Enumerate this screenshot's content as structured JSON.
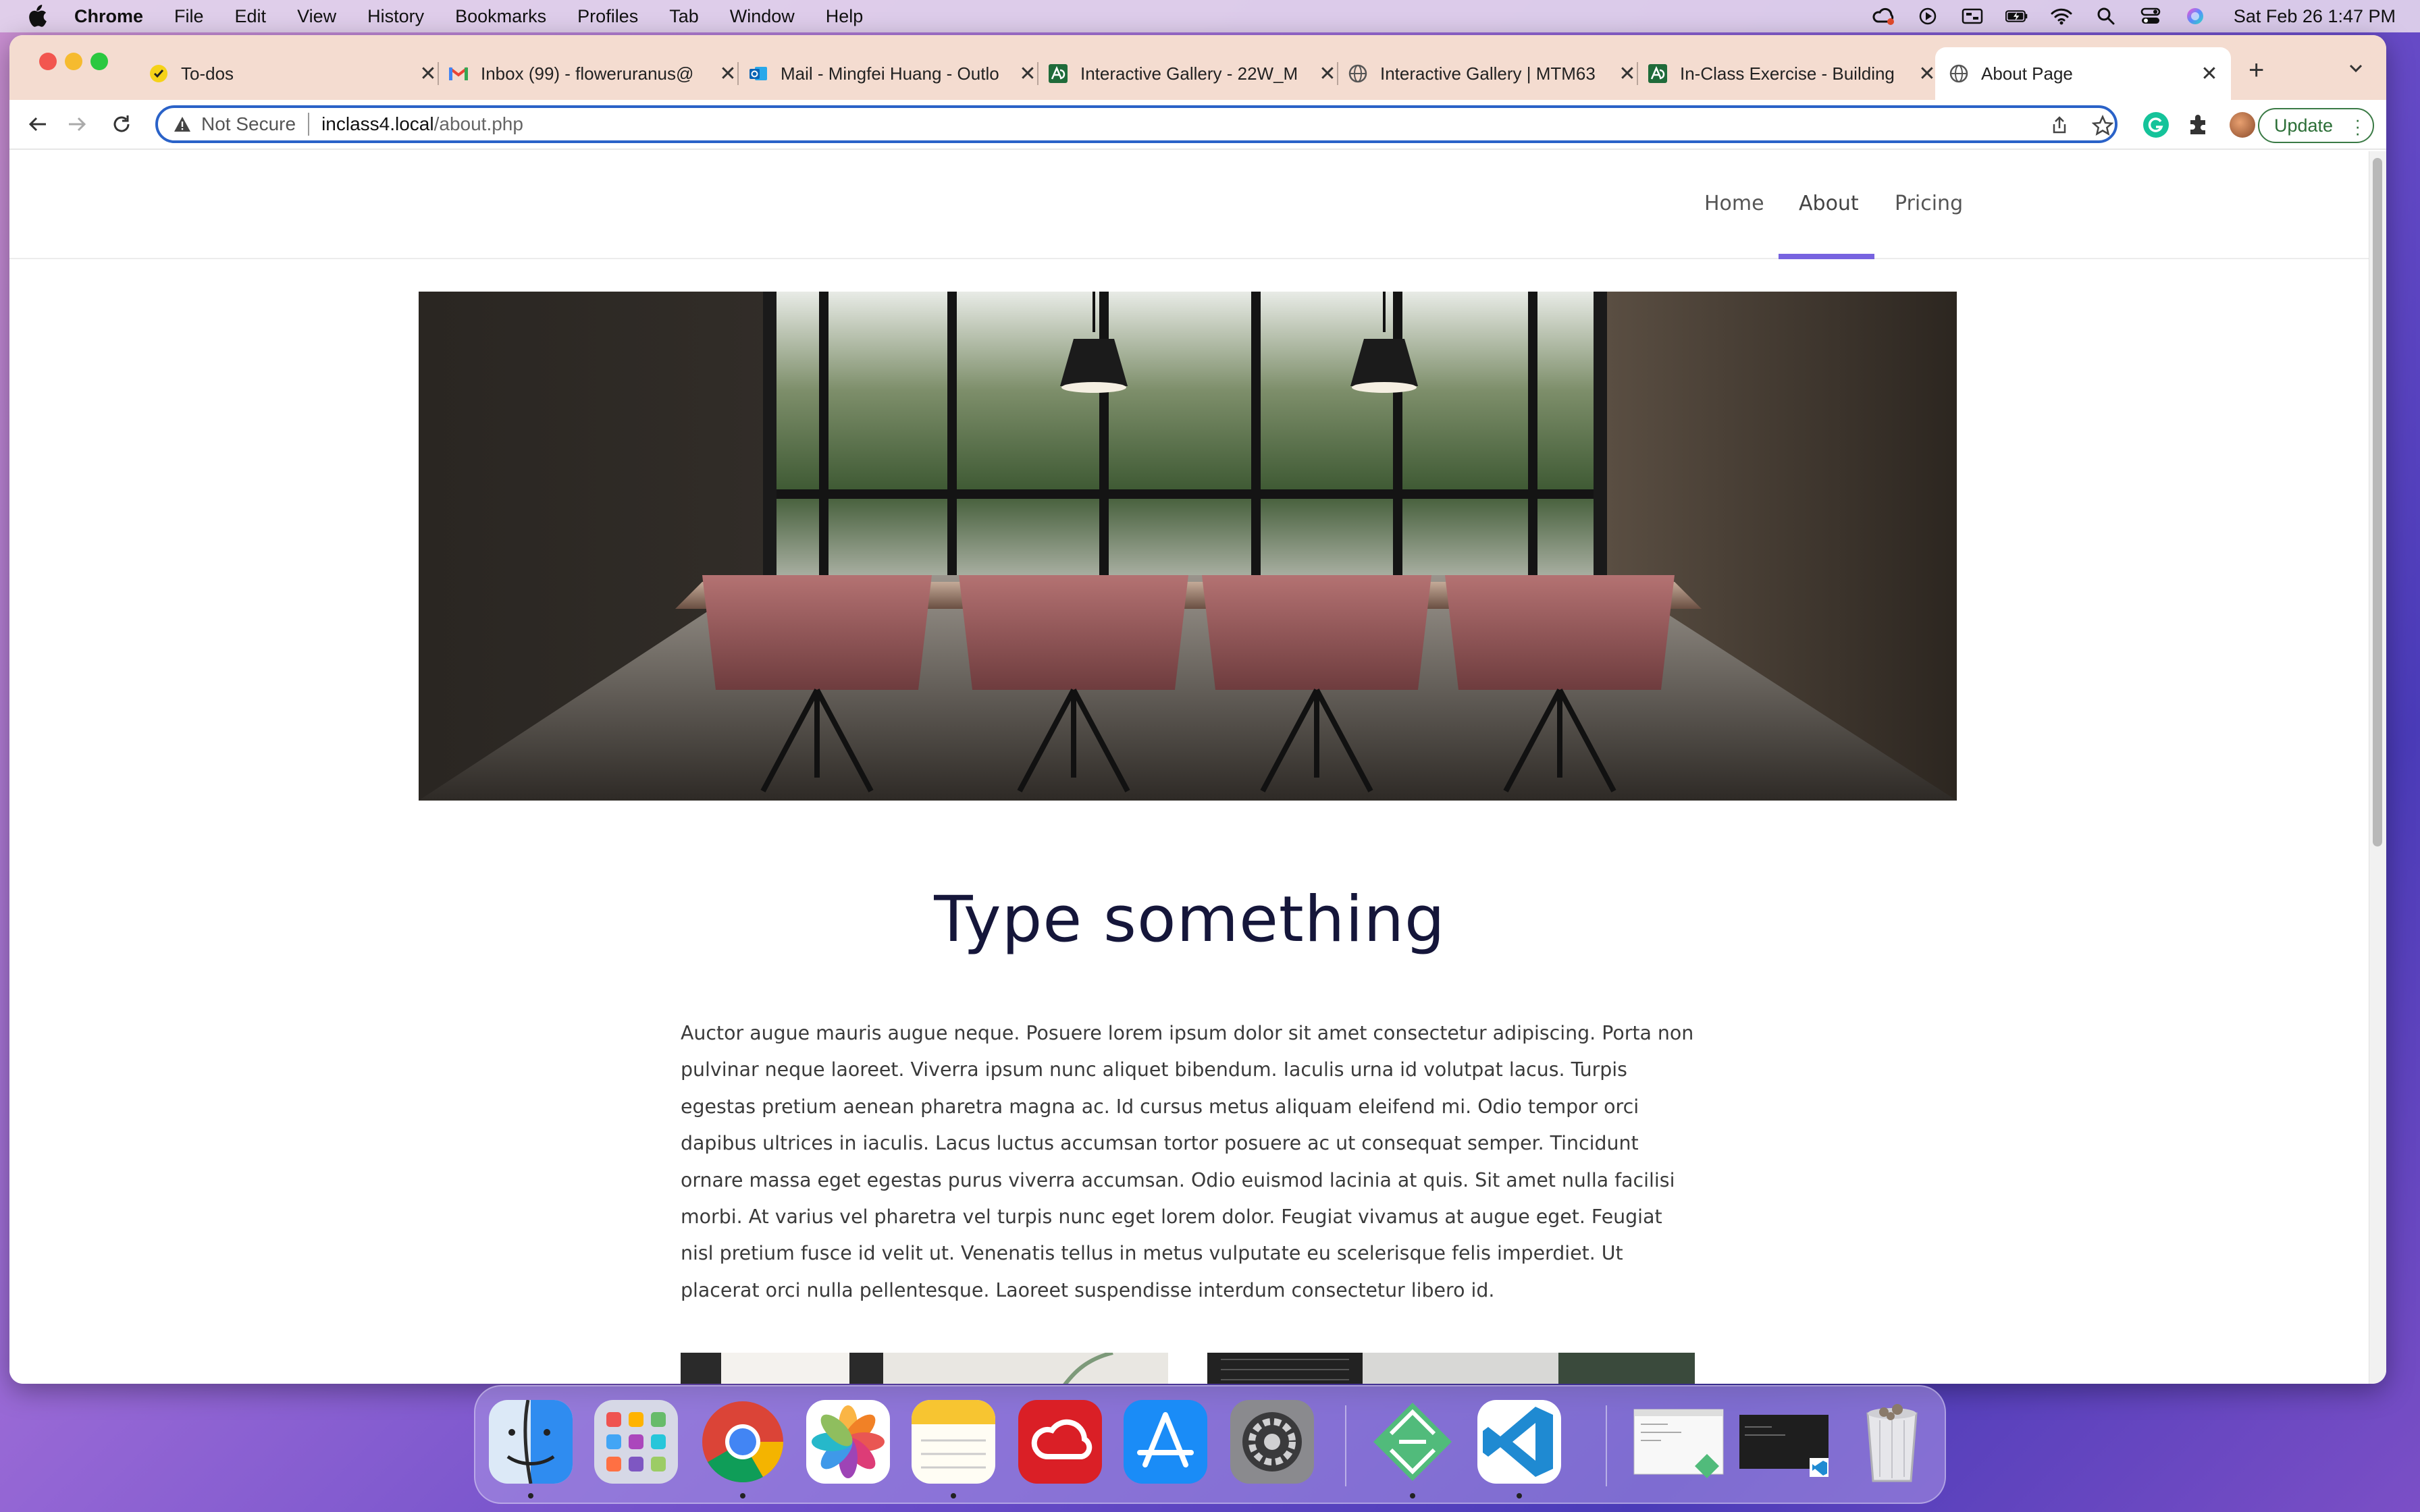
{
  "menubar": {
    "app": "Chrome",
    "items": [
      "File",
      "Edit",
      "View",
      "History",
      "Bookmarks",
      "Profiles",
      "Tab",
      "Window",
      "Help"
    ],
    "clock": "Sat Feb 26  1:47 PM"
  },
  "tabs": [
    {
      "title": "To-dos",
      "icon": "todo-icon"
    },
    {
      "title": "Inbox (99) - floweruranus@",
      "icon": "gmail-icon"
    },
    {
      "title": "Mail - Mingfei Huang - Outlo",
      "icon": "outlook-icon"
    },
    {
      "title": "Interactive Gallery - 22W_M",
      "icon": "course-icon"
    },
    {
      "title": "Interactive Gallery | MTM63",
      "icon": "globe-icon"
    },
    {
      "title": "In-Class Exercise - Building",
      "icon": "course-icon"
    },
    {
      "title": "About Page",
      "icon": "globe-icon"
    }
  ],
  "address": {
    "security": "Not Secure",
    "host": "inclass4.local",
    "path": "/about.php"
  },
  "toolbar": {
    "update_label": "Update"
  },
  "site": {
    "nav": [
      "Home",
      "About",
      "Pricing"
    ],
    "active_nav": "About",
    "heading": "Type something",
    "body": "Auctor augue mauris augue neque. Posuere lorem ipsum dolor sit amet consectetur adipiscing. Porta non pulvinar neque laoreet. Viverra ipsum nunc aliquet bibendum. Iaculis urna id volutpat lacus. Turpis egestas pretium aenean pharetra magna ac. Id cursus metus aliquam eleifend mi. Odio tempor orci dapibus ultrices in iaculis. Lacus luctus accumsan tortor posuere ac ut consequat semper. Tincidunt ornare massa eget egestas purus viverra accumsan. Odio euismod lacinia at quis. Sit amet nulla facilisi morbi. At varius vel pharetra vel turpis nunc eget lorem dolor. Feugiat vivamus at augue eget. Feugiat nisl pretium fusce id velit ut. Venenatis tellus in metus vulputate eu scelerisque felis imperdiet. Ut placerat orci nulla pellentesque. Laoreet suspendisse interdum consectetur libero id."
  },
  "colors": {
    "accent": "#7763e0",
    "heading": "#15163a",
    "omnibox_border": "#2a62c8"
  },
  "dock": [
    "finder-icon",
    "launchpad-icon",
    "chrome-icon",
    "photos-icon",
    "notes-icon",
    "creative-cloud-icon",
    "app-store-icon",
    "system-preferences-icon",
    "local-icon",
    "vscode-icon",
    "window-preview-icon",
    "terminal-preview-icon",
    "trash-icon"
  ]
}
